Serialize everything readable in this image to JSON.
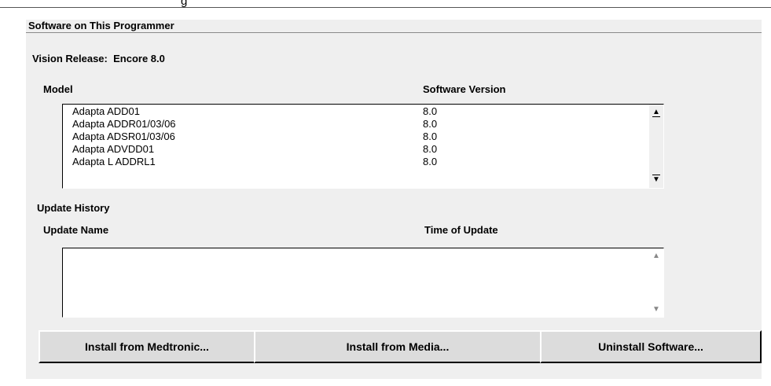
{
  "caption": {
    "label": "",
    "text": "g"
  },
  "panel": {
    "title": "Software on This Programmer",
    "vision_release_label": "Vision Release:",
    "vision_release_value": "Encore 8.0"
  },
  "software_list": {
    "columns": [
      "Model",
      "Software Version"
    ],
    "rows": [
      {
        "model": "Adapta ADD01",
        "version": "8.0"
      },
      {
        "model": "Adapta ADDR01/03/06",
        "version": "8.0"
      },
      {
        "model": "Adapta ADSR01/03/06",
        "version": "8.0"
      },
      {
        "model": "Adapta ADVDD01",
        "version": "8.0"
      },
      {
        "model": "Adapta L ADDRL1",
        "version": "8.0"
      }
    ]
  },
  "update_history": {
    "title": "Update History",
    "columns": [
      "Update Name",
      "Time of Update"
    ],
    "rows": []
  },
  "buttons": {
    "install_medtronic": "Install from Medtronic...",
    "install_media": "Install from Media...",
    "uninstall": "Uninstall Software..."
  }
}
